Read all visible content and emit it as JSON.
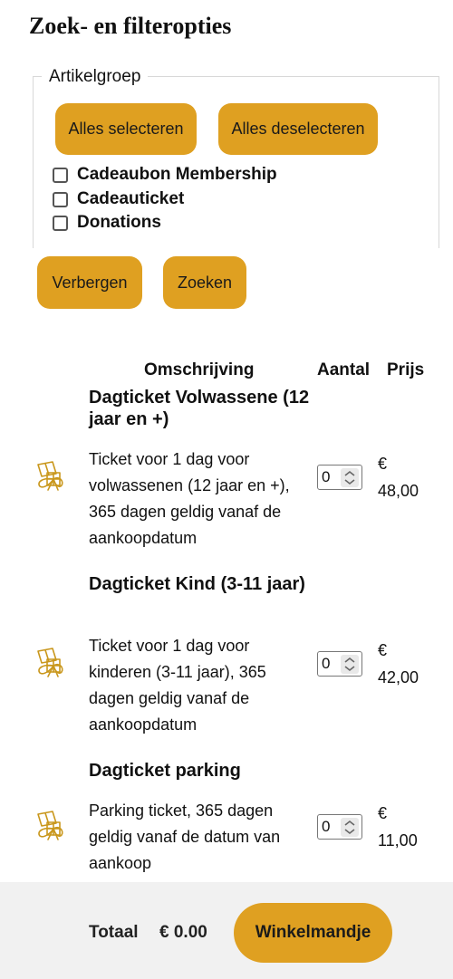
{
  "title": "Zoek- en filteropties",
  "filter": {
    "legend": "Artikelgroep",
    "select_all": "Alles selecteren",
    "deselect_all": "Alles deselecteren",
    "groups": [
      {
        "label": "Cadeaubon Membership",
        "checked": false
      },
      {
        "label": "Cadeauticket",
        "checked": false
      },
      {
        "label": "Donations",
        "checked": false
      }
    ],
    "hide_label": "Verbergen",
    "search_label": "Zoeken"
  },
  "table": {
    "headers": {
      "description": "Omschrijving",
      "quantity": "Aantal",
      "price": "Prijs"
    },
    "products": [
      {
        "title": "Dagticket Volwassene (12 jaar en +)",
        "description": "Ticket voor 1 dag voor volwassenen (12 jaar en +), 365 dagen geldig vanaf de aankoopdatum",
        "quantity": "0",
        "currency": "€",
        "price": "48,00",
        "icon": "gift-ticket-icon"
      },
      {
        "title": "Dagticket Kind (3-11 jaar)",
        "description": "Ticket voor 1 dag voor kinderen (3-11 jaar), 365 dagen geldig vanaf de aankoopdatum",
        "quantity": "0",
        "currency": "€",
        "price": "42,00",
        "icon": "gift-ticket-icon"
      },
      {
        "title": "Dagticket parking",
        "description": "Parking ticket, 365 dagen geldig vanaf de datum van aankoop",
        "quantity": "0",
        "currency": "€",
        "price": "11,00",
        "icon": "gift-ticket-icon"
      }
    ]
  },
  "footer": {
    "total_label": "Totaal",
    "total_value": "€ 0.00",
    "cart_label": "Winkelmandje"
  },
  "colors": {
    "accent": "#dfa021",
    "icon": "#c9971c",
    "footer_bg": "#f1f1f1"
  }
}
